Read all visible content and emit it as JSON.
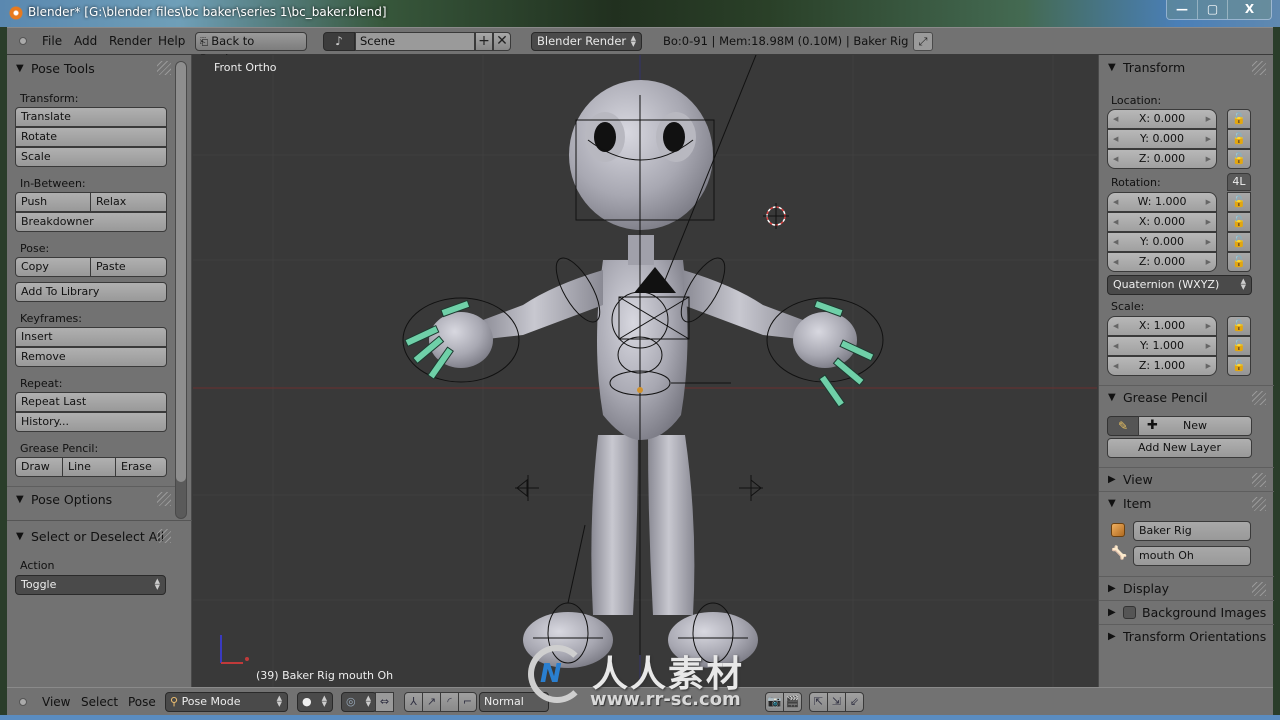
{
  "window": {
    "title": "Blender* [G:\\blender files\\bc baker\\series 1\\bc_baker.blend]",
    "controls": {
      "minimize": "—",
      "maximize": "▢",
      "close": "X"
    }
  },
  "info_header": {
    "menus": [
      "File",
      "Add",
      "Render",
      "Help"
    ],
    "back_button": "Back to Previous",
    "scene_name": "Scene",
    "scene_add": "+",
    "scene_remove": "✕",
    "render_engine": "Blender Render",
    "stats": "Bo:0-91  | Mem:18.98M (0.10M) | Baker Rig"
  },
  "tool_shelf": {
    "pose_tools": {
      "title": "Pose Tools",
      "transform_label": "Transform:",
      "translate": "Translate",
      "rotate": "Rotate",
      "scale": "Scale",
      "inbetween_label": "In-Between:",
      "push": "Push",
      "relax": "Relax",
      "breakdowner": "Breakdowner",
      "pose_label": "Pose:",
      "copy": "Copy",
      "paste": "Paste",
      "add_to_library": "Add To Library",
      "keyframes_label": "Keyframes:",
      "insert": "Insert",
      "remove": "Remove",
      "repeat_label": "Repeat:",
      "repeat_last": "Repeat Last",
      "history": "History...",
      "grease_label": "Grease Pencil:",
      "draw": "Draw",
      "line": "Line",
      "erase": "Erase"
    },
    "pose_options": {
      "title": "Pose Options"
    },
    "operator": {
      "title": "Select or Deselect All",
      "action_label": "Action",
      "action_value": "Toggle"
    }
  },
  "viewport": {
    "view_name": "Front Ortho",
    "object_info": "(39) Baker Rig mouth Oh"
  },
  "properties": {
    "transform": {
      "title": "Transform",
      "location_label": "Location:",
      "location": [
        "X: 0.000",
        "Y: 0.000",
        "Z: 0.000"
      ],
      "rotation_label": "Rotation:",
      "rotation_lock_4l": "4L",
      "rotation": [
        "W: 1.000",
        "X: 0.000",
        "Y: 0.000",
        "Z: 0.000"
      ],
      "rotation_mode": "Quaternion (WXYZ)",
      "scale_label": "Scale:",
      "scale": [
        "X: 1.000",
        "Y: 1.000",
        "Z: 1.000"
      ]
    },
    "grease_pencil": {
      "title": "Grease Pencil",
      "new": "New",
      "add_new_layer": "Add New Layer"
    },
    "view": {
      "title": "View"
    },
    "item": {
      "title": "Item",
      "object_name": "Baker Rig",
      "bone_name": "mouth Oh"
    },
    "display": {
      "title": "Display"
    },
    "background_images": {
      "title": "Background Images",
      "enabled": false
    },
    "transform_orientations": {
      "title": "Transform Orientations"
    }
  },
  "view3d_header": {
    "menus": [
      "View",
      "Select",
      "Pose"
    ],
    "mode": "Pose Mode",
    "orientation": "Normal"
  },
  "watermark": {
    "text": "人人素材",
    "url": "www.rr-sc.com"
  },
  "colors": {
    "panel_bg": "#727272",
    "viewport_bg": "#393939",
    "bone_selected": "#6fd0a8",
    "x_axis": "#b03030",
    "z_axis": "#3030b0"
  }
}
